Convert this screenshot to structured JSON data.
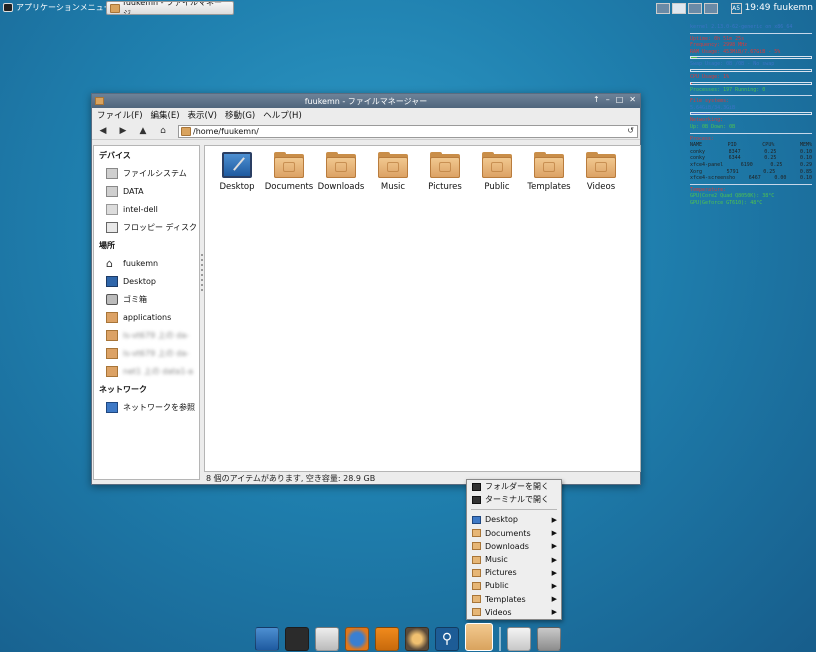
{
  "top_panel": {
    "app_menu_label": "アプリケーションメニュー",
    "task_button_label": "fuukemn - ファイルマネージ...",
    "clock": "19:49",
    "user": "fuukemn",
    "ime": "A5"
  },
  "conky": {
    "kernel": "kernel 2.13.0-62-generic on x86_64",
    "uptime": "Uptime:  0h 51m 25s",
    "frequency": "Frequency:  2998 MHz",
    "ram": "RAM Usage:  453MiB/7.67GiB - 5%",
    "swap": "Swap Usage:  0B  /0B  - No swap",
    "cpu": "CPU Usage:  1%",
    "processes": "Processes:  197  Running: 0",
    "file_systems": "File systems:",
    "fs_usage": "5.64GiB/34.3GiB",
    "networking": "Networking:",
    "net": "Up: 0B    Down: 0B",
    "processes_head": "Process:",
    "proc_cols": [
      "NAME",
      "PID",
      "CPU%",
      "MEM%"
    ],
    "procs": [
      [
        "conky",
        "8347",
        "0.25",
        "0.10"
      ],
      [
        "conky",
        "6344",
        "0.25",
        "0.10"
      ],
      [
        "xfce4-panel",
        "6190",
        "0.25",
        "0.29"
      ],
      [
        "Xorg",
        "5791",
        "0.25",
        "0.85"
      ],
      [
        "xfce4-screensho",
        "6467",
        "0.00",
        "0.10"
      ]
    ],
    "temperature": "Temperature:",
    "temp1": "GPU(Core2 Quad Q8050K):     38°C",
    "temp2": "GPU(Geforce GT610):          48°C"
  },
  "window": {
    "title": "fuukemn - ファイルマネージャー",
    "menu": [
      "ファイル(F)",
      "編集(E)",
      "表示(V)",
      "移動(G)",
      "ヘルプ(H)"
    ],
    "path": "/home/fuukemn/",
    "sidebar": {
      "devices_head": "デバイス",
      "devices": [
        "ファイルシステム",
        "DATA",
        "intel-dell",
        "フロッピー ディスク"
      ],
      "places_head": "場所",
      "places": [
        "fuukemn",
        "Desktop",
        "ゴミ箱",
        "applications",
        "ls-vt679 上の da-",
        "ls-vt679 上の da-",
        "net1 上の data1-a"
      ],
      "network_head": "ネットワーク",
      "network": [
        "ネットワークを参照"
      ]
    },
    "files": [
      "Desktop",
      "Documents",
      "Downloads",
      "Music",
      "Pictures",
      "Public",
      "Templates",
      "Videos"
    ],
    "status": "8 個のアイテムがあります, 空き容量: 28.9 GB"
  },
  "popup": {
    "open_folder": "フォルダーを開く",
    "open_terminal": "ターミナルで開く",
    "items": [
      "Desktop",
      "Documents",
      "Downloads",
      "Music",
      "Pictures",
      "Public",
      "Templates",
      "Videos"
    ]
  }
}
